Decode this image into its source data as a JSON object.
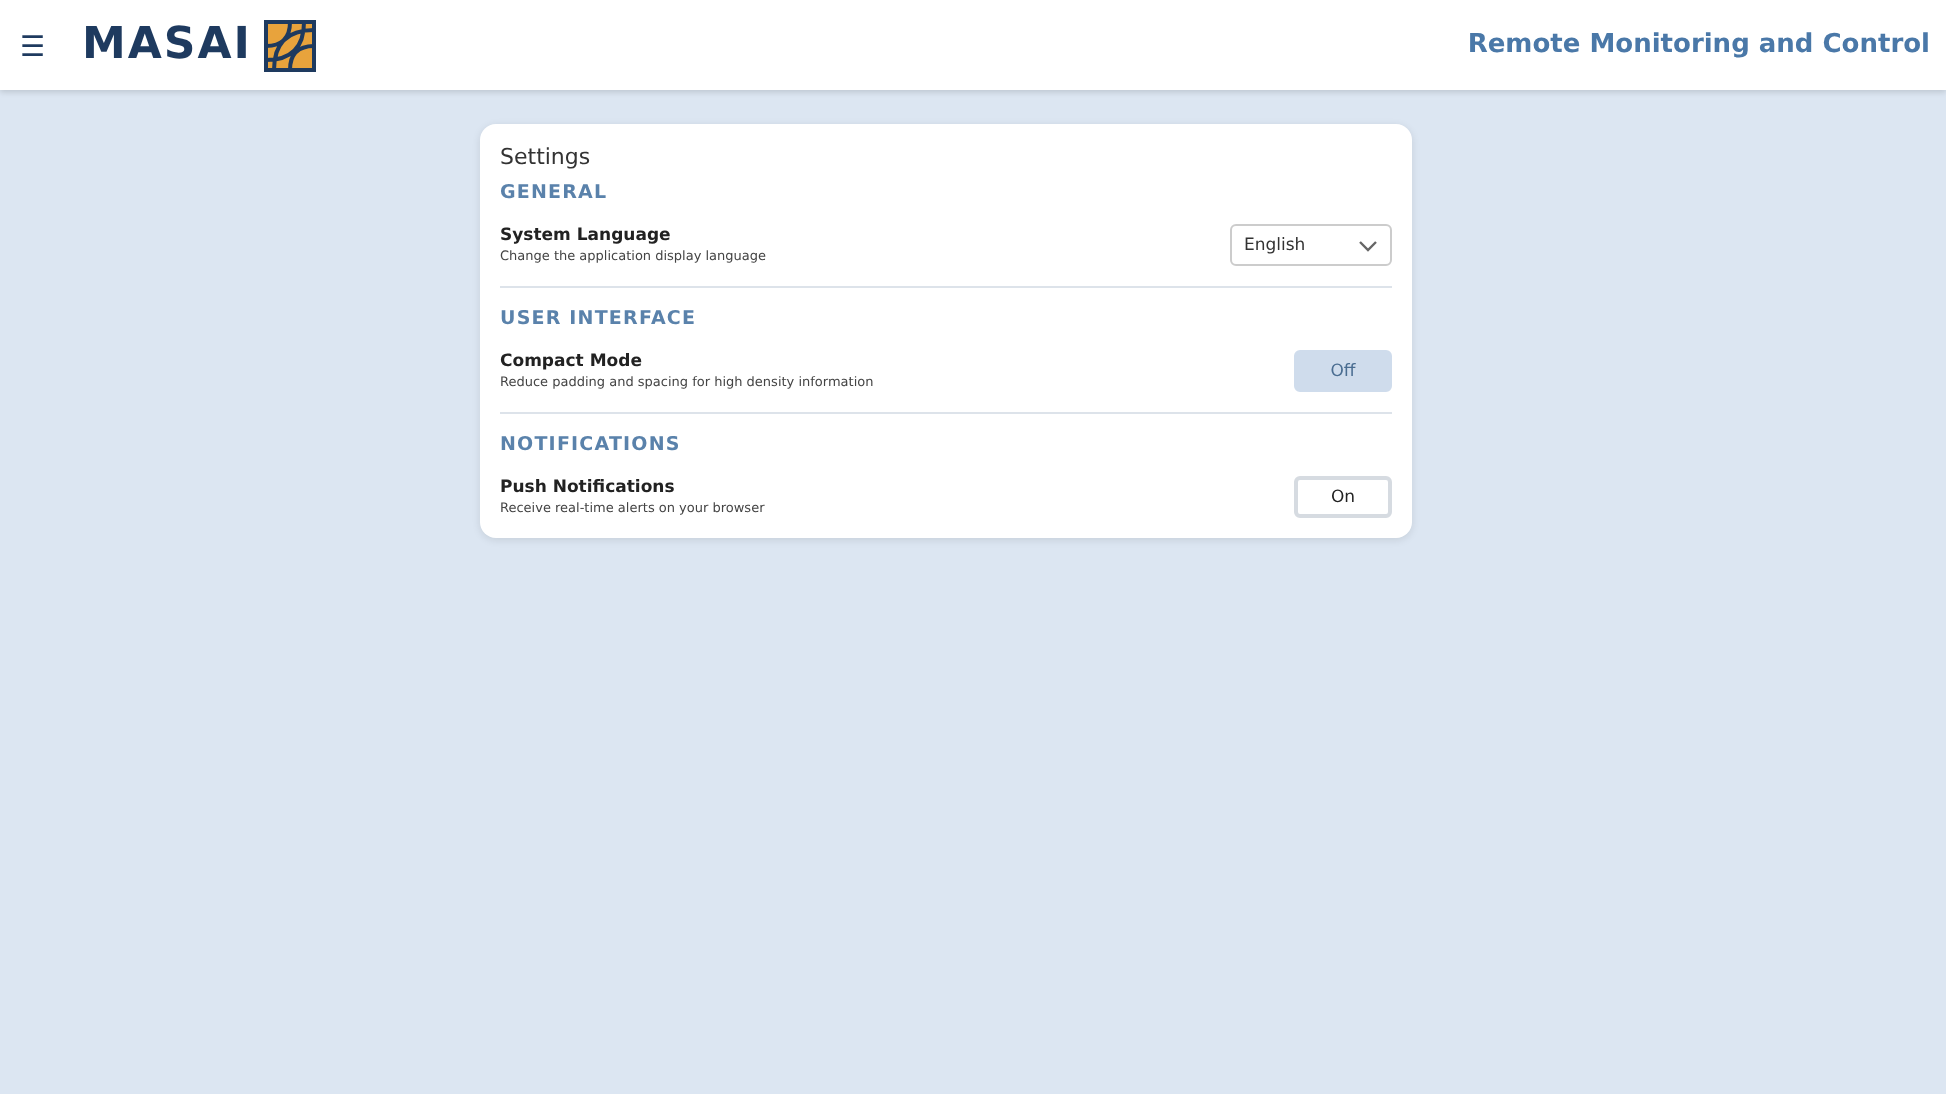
{
  "header": {
    "menu_icon": "☰",
    "logo": "MASAI",
    "title": "Remote Monitoring and Control"
  },
  "settings": {
    "title": "Settings",
    "sections": [
      {
        "heading": "GENERAL",
        "rows": [
          {
            "kind": "select",
            "label": "System Language",
            "description": "Change the application display language",
            "value": "English"
          }
        ]
      },
      {
        "heading": "USER INTERFACE",
        "rows": [
          {
            "kind": "toggle",
            "label": "Compact Mode",
            "description": "Reduce padding and spacing for high density information",
            "on": false,
            "value": "Off"
          }
        ]
      },
      {
        "heading": "NOTIFICATIONS",
        "rows": [
          {
            "kind": "toggle",
            "label": "Push Notifications",
            "description": "Receive real-time alerts on your browser",
            "on": true,
            "value": "On"
          }
        ]
      }
    ]
  }
}
